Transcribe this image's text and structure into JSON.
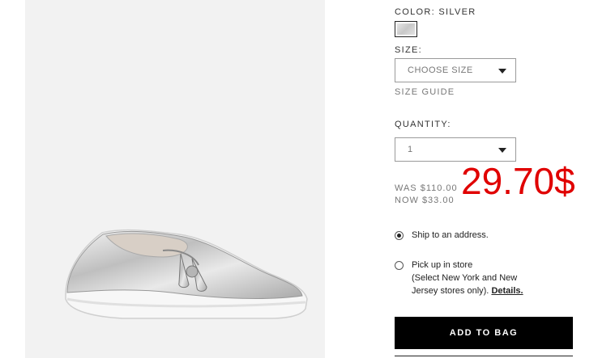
{
  "product": {
    "color_label": "COLOR:",
    "color_value": "SILVER",
    "swatch_color": "#d4d4d4",
    "size_label": "SIZE:",
    "size_select": "CHOOSE SIZE",
    "size_guide": "SIZE GUIDE",
    "quantity_label": "QUANTITY:",
    "quantity_value": "1",
    "was_price": "WAS $110.00",
    "now_price": "NOW $33.00",
    "annotation_price": "29.70$",
    "annotation_color": "#e00000",
    "shipping": {
      "option_ship": "Ship to an address.",
      "option_pickup_line1": "Pick up in store",
      "option_pickup_line2": "(Select New York and New",
      "option_pickup_line3": "Jersey stores only).",
      "details_link": "Details."
    },
    "add_to_bag": "ADD TO BAG"
  }
}
